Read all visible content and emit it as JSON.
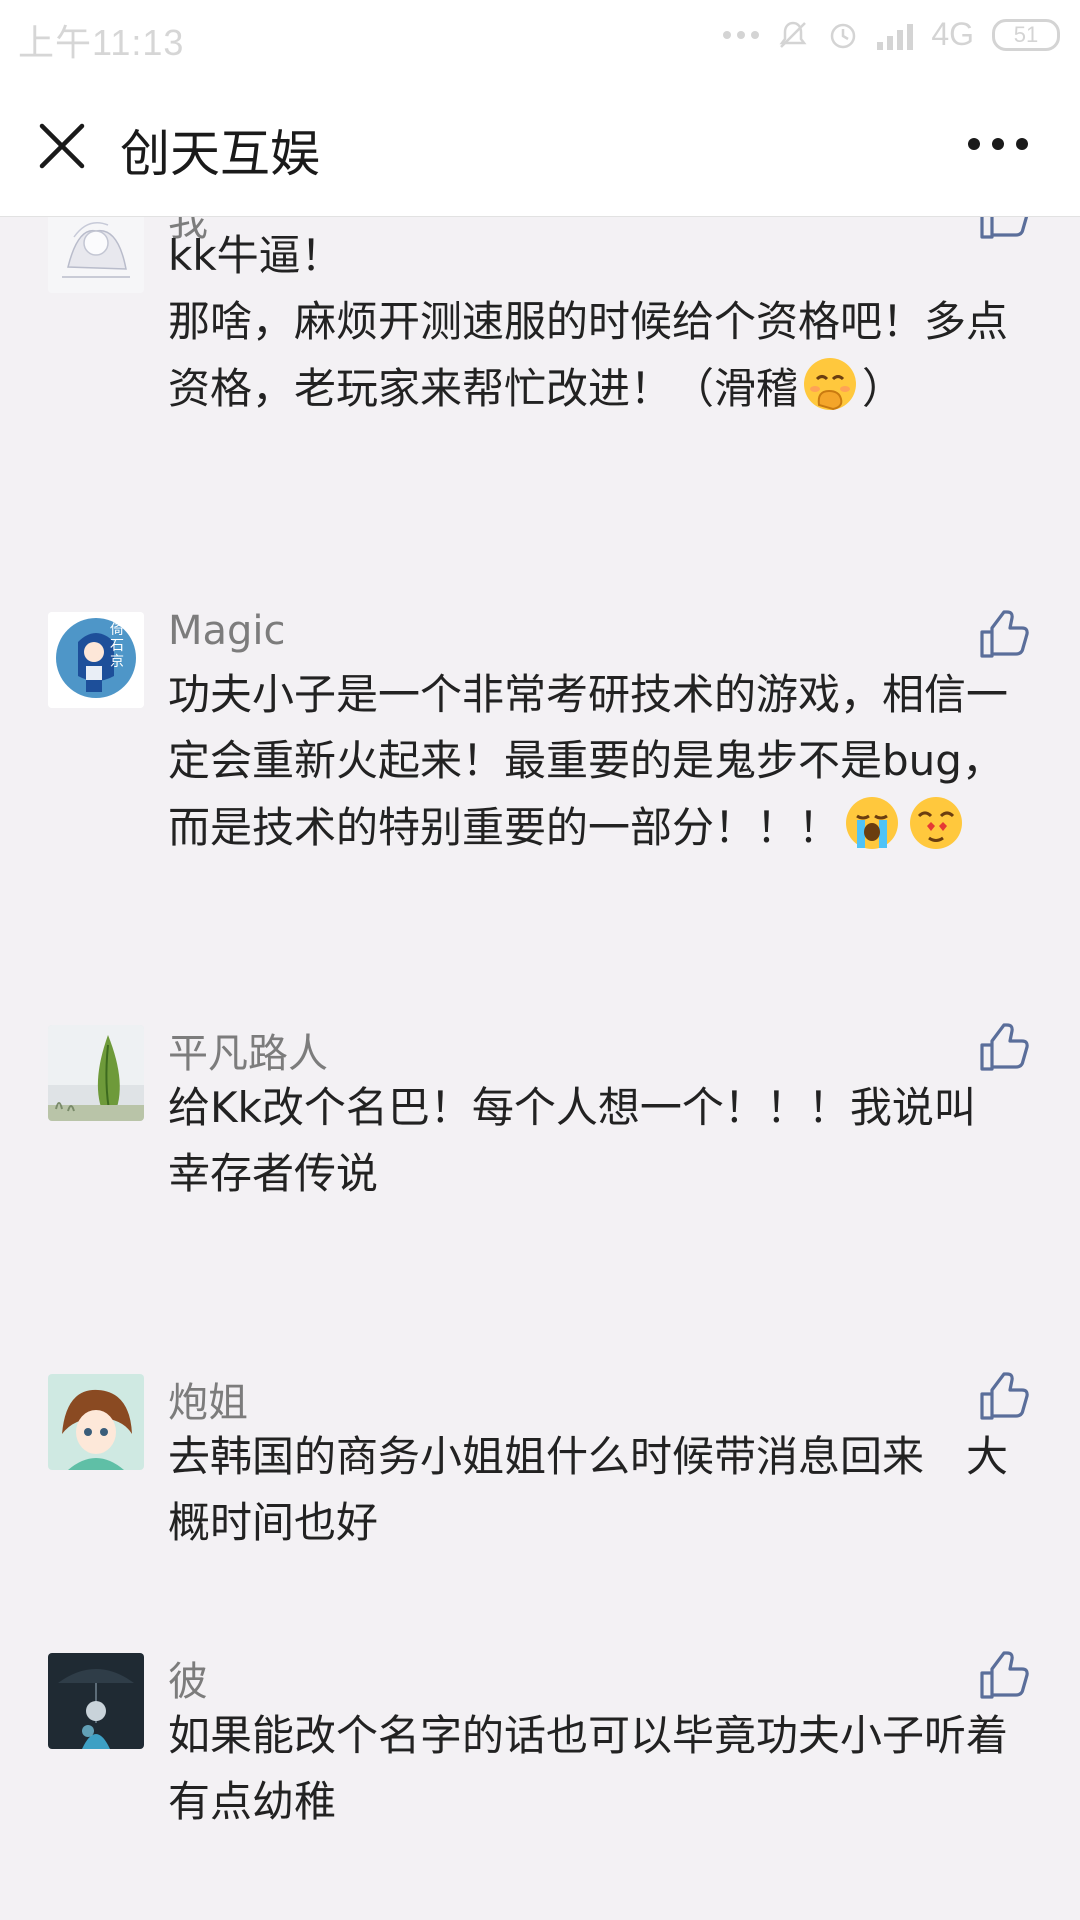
{
  "status_bar": {
    "time": "上午11:13",
    "network": "4G",
    "battery": "51"
  },
  "header": {
    "title": "创天互娱",
    "close_icon": "close-icon",
    "more_icon": "more-icon"
  },
  "comments": [
    {
      "author": "我",
      "text": "kk牛逼！\n那啥，麻烦开测速服的时候给个资格吧！多点资格，老玩家来帮忙改进！（滑稽",
      "text_end": "）",
      "emoji": [
        "hand-over-mouth-emoji"
      ]
    },
    {
      "author": "Magic",
      "avatar_text": "倚\n石\n京",
      "text": "功夫小子是一个非常考研技术的游戏，相信一定会重新火起来！最重要的是鬼步不是bug，而是技术的特别重要的一部分！！！",
      "emoji": [
        "crying-face-emoji",
        "heart-eyes-emoji"
      ]
    },
    {
      "author": "平凡路人",
      "text": "给Kk改个名巴！每个人想一个！！！我说叫\n幸存者传说"
    },
    {
      "author": "炮姐",
      "text": "去韩国的商务小姐姐什么时候带消息回来　大概时间也好"
    },
    {
      "author": "彼",
      "text": "如果能改个名字的话也可以毕竟功夫小子听着有点幼稚"
    }
  ],
  "icons": {
    "like": "thumbs-up-icon"
  },
  "colors": {
    "background": "#f3f1f4",
    "header": "#ffffff",
    "author_name": "#7c7c7c",
    "like_icon": "#5a6e9a"
  }
}
